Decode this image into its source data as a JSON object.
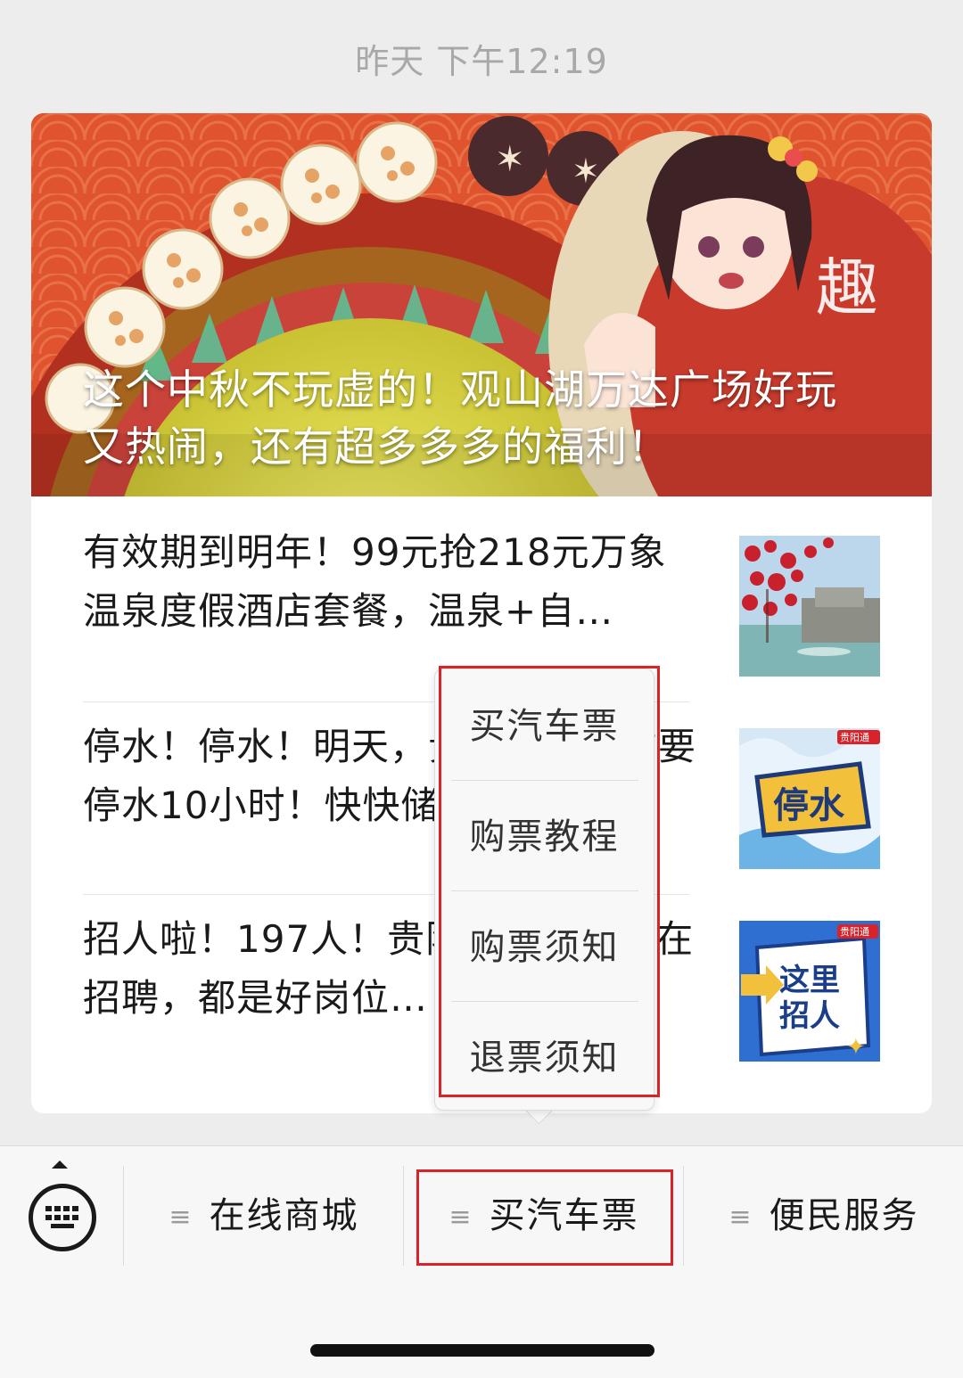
{
  "timestamp": "昨天 下午12:19",
  "cover_article": {
    "title": "这个中秋不玩虚的！观山湖万达广场好玩又热闹，还有超多多多的福利！"
  },
  "articles": [
    {
      "title": "有效期到明年！99元抢218元万象温泉度假酒店套餐，温泉+自…",
      "thumb_icon": "hot-spring-photo"
    },
    {
      "title": "停水！停水！明天，贵阳这些地方要停水10小时！快快储水…",
      "thumb_icon": "water-outage-poster",
      "thumb_text": "停水",
      "thumb_badge": "贵阳通"
    },
    {
      "title": "招人啦！197人！贵阳这些单位正在招聘，都是好岗位…",
      "thumb_icon": "hiring-poster",
      "thumb_text_1": "这里",
      "thumb_text_2": "招人",
      "thumb_badge": "贵阳通"
    }
  ],
  "popup_menu": {
    "items": [
      "买汽车票",
      "购票教程",
      "购票须知",
      "退票须知"
    ]
  },
  "bottom_menu": {
    "keyboard_icon": "keyboard-icon",
    "items": [
      "在线商城",
      "买汽车票",
      "便民服务"
    ],
    "item_icon": "≡"
  },
  "colors": {
    "highlight": "#d9232a",
    "cover_red": "#d9442a",
    "page_bg": "#ededed"
  }
}
